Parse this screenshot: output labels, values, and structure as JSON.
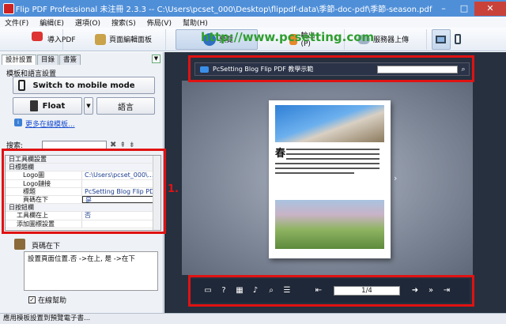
{
  "titlebar": {
    "title": "Flip PDF Professional 未注冊 2.3.3   -- C:\\Users\\pcset_000\\Desktop\\flippdf-data\\季節-doc-pdf\\季節-season.pdf",
    "min": "–",
    "max": "□",
    "close": "✕"
  },
  "menubar": {
    "items": [
      "文件(F)",
      "編緝(E)",
      "選項(O)",
      "搜索(S)",
      "佈局(V)",
      "幫助(H)"
    ]
  },
  "toolbar": {
    "import_pdf": "導入PDF",
    "page_editor": "頁面編輯面板",
    "preview": "預覽",
    "output": "輸出(P)",
    "upload": "服務器上傳",
    "watermark": "http://www.pcsetting.com"
  },
  "leftpanel": {
    "tabs": [
      "設計設置",
      "目錄",
      "書簽"
    ],
    "section_label": "模板和語言設置",
    "mobile_button": "Switch to mobile mode",
    "float_button": "Float",
    "language_button": "語言",
    "more_templates": "更多在線模板...",
    "search_label": "搜索:",
    "grid": [
      {
        "type": "cat",
        "key": "日工具欄設置"
      },
      {
        "type": "cat",
        "key": " 日標題欄"
      },
      {
        "type": "row",
        "key": "Logo圖",
        "value": "C:\\Users\\pcset_000\\..."
      },
      {
        "type": "row",
        "key": "Logo鏈接",
        "value": ""
      },
      {
        "type": "row",
        "key": "標題",
        "value": "PcSetting Blog Flip PD..."
      },
      {
        "type": "sel",
        "key": "頁碼在下",
        "value": "是"
      },
      {
        "type": "cat",
        "key": " 日按鈕欄"
      },
      {
        "type": "row",
        "key": "工具欄在上",
        "value": "否"
      },
      {
        "type": "row",
        "key": "添加圖標設置",
        "value": ""
      }
    ],
    "desc_title": "頁碼在下",
    "desc_text": "設置頁面位置.否 ->在上, 是 ->在下",
    "online_help": "在線幫助"
  },
  "preview": {
    "book_title": "PcSetting Blog Flip PDF 教學示範",
    "page_indicator": "1/4",
    "book_char": "春"
  },
  "annotation": {
    "label": "1."
  },
  "statusbar": {
    "text": "應用模板設置到預覽電子書..."
  },
  "colors": {
    "titlebar": "#4f8fd8",
    "annotation_red": "#e01212",
    "preview_bg": "#26303f"
  }
}
